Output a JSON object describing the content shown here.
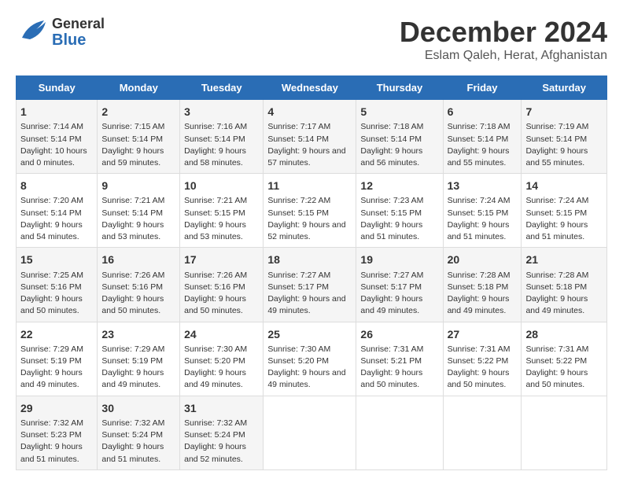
{
  "header": {
    "logo_general": "General",
    "logo_blue": "Blue",
    "title": "December 2024",
    "subtitle": "Eslam Qaleh, Herat, Afghanistan"
  },
  "calendar": {
    "days_of_week": [
      "Sunday",
      "Monday",
      "Tuesday",
      "Wednesday",
      "Thursday",
      "Friday",
      "Saturday"
    ],
    "weeks": [
      [
        null,
        null,
        null,
        null,
        null,
        null,
        null
      ]
    ]
  },
  "cells": {
    "w1": [
      null,
      null,
      null,
      null,
      null,
      null,
      null
    ]
  },
  "days": [
    {
      "num": "1",
      "sunrise": "7:14 AM",
      "sunset": "5:14 PM",
      "daylight": "10 hours and 0 minutes."
    },
    {
      "num": "2",
      "sunrise": "7:15 AM",
      "sunset": "5:14 PM",
      "daylight": "9 hours and 59 minutes."
    },
    {
      "num": "3",
      "sunrise": "7:16 AM",
      "sunset": "5:14 PM",
      "daylight": "9 hours and 58 minutes."
    },
    {
      "num": "4",
      "sunrise": "7:17 AM",
      "sunset": "5:14 PM",
      "daylight": "9 hours and 57 minutes."
    },
    {
      "num": "5",
      "sunrise": "7:18 AM",
      "sunset": "5:14 PM",
      "daylight": "9 hours and 56 minutes."
    },
    {
      "num": "6",
      "sunrise": "7:18 AM",
      "sunset": "5:14 PM",
      "daylight": "9 hours and 55 minutes."
    },
    {
      "num": "7",
      "sunrise": "7:19 AM",
      "sunset": "5:14 PM",
      "daylight": "9 hours and 55 minutes."
    },
    {
      "num": "8",
      "sunrise": "7:20 AM",
      "sunset": "5:14 PM",
      "daylight": "9 hours and 54 minutes."
    },
    {
      "num": "9",
      "sunrise": "7:21 AM",
      "sunset": "5:14 PM",
      "daylight": "9 hours and 53 minutes."
    },
    {
      "num": "10",
      "sunrise": "7:21 AM",
      "sunset": "5:15 PM",
      "daylight": "9 hours and 53 minutes."
    },
    {
      "num": "11",
      "sunrise": "7:22 AM",
      "sunset": "5:15 PM",
      "daylight": "9 hours and 52 minutes."
    },
    {
      "num": "12",
      "sunrise": "7:23 AM",
      "sunset": "5:15 PM",
      "daylight": "9 hours and 51 minutes."
    },
    {
      "num": "13",
      "sunrise": "7:24 AM",
      "sunset": "5:15 PM",
      "daylight": "9 hours and 51 minutes."
    },
    {
      "num": "14",
      "sunrise": "7:24 AM",
      "sunset": "5:15 PM",
      "daylight": "9 hours and 51 minutes."
    },
    {
      "num": "15",
      "sunrise": "7:25 AM",
      "sunset": "5:16 PM",
      "daylight": "9 hours and 50 minutes."
    },
    {
      "num": "16",
      "sunrise": "7:26 AM",
      "sunset": "5:16 PM",
      "daylight": "9 hours and 50 minutes."
    },
    {
      "num": "17",
      "sunrise": "7:26 AM",
      "sunset": "5:16 PM",
      "daylight": "9 hours and 50 minutes."
    },
    {
      "num": "18",
      "sunrise": "7:27 AM",
      "sunset": "5:17 PM",
      "daylight": "9 hours and 49 minutes."
    },
    {
      "num": "19",
      "sunrise": "7:27 AM",
      "sunset": "5:17 PM",
      "daylight": "9 hours and 49 minutes."
    },
    {
      "num": "20",
      "sunrise": "7:28 AM",
      "sunset": "5:18 PM",
      "daylight": "9 hours and 49 minutes."
    },
    {
      "num": "21",
      "sunrise": "7:28 AM",
      "sunset": "5:18 PM",
      "daylight": "9 hours and 49 minutes."
    },
    {
      "num": "22",
      "sunrise": "7:29 AM",
      "sunset": "5:19 PM",
      "daylight": "9 hours and 49 minutes."
    },
    {
      "num": "23",
      "sunrise": "7:29 AM",
      "sunset": "5:19 PM",
      "daylight": "9 hours and 49 minutes."
    },
    {
      "num": "24",
      "sunrise": "7:30 AM",
      "sunset": "5:20 PM",
      "daylight": "9 hours and 49 minutes."
    },
    {
      "num": "25",
      "sunrise": "7:30 AM",
      "sunset": "5:20 PM",
      "daylight": "9 hours and 49 minutes."
    },
    {
      "num": "26",
      "sunrise": "7:31 AM",
      "sunset": "5:21 PM",
      "daylight": "9 hours and 50 minutes."
    },
    {
      "num": "27",
      "sunrise": "7:31 AM",
      "sunset": "5:22 PM",
      "daylight": "9 hours and 50 minutes."
    },
    {
      "num": "28",
      "sunrise": "7:31 AM",
      "sunset": "5:22 PM",
      "daylight": "9 hours and 50 minutes."
    },
    {
      "num": "29",
      "sunrise": "7:32 AM",
      "sunset": "5:23 PM",
      "daylight": "9 hours and 51 minutes."
    },
    {
      "num": "30",
      "sunrise": "7:32 AM",
      "sunset": "5:24 PM",
      "daylight": "9 hours and 51 minutes."
    },
    {
      "num": "31",
      "sunrise": "7:32 AM",
      "sunset": "5:24 PM",
      "daylight": "9 hours and 52 minutes."
    }
  ],
  "labels": {
    "sunrise": "Sunrise:",
    "sunset": "Sunset:",
    "daylight": "Daylight:"
  }
}
